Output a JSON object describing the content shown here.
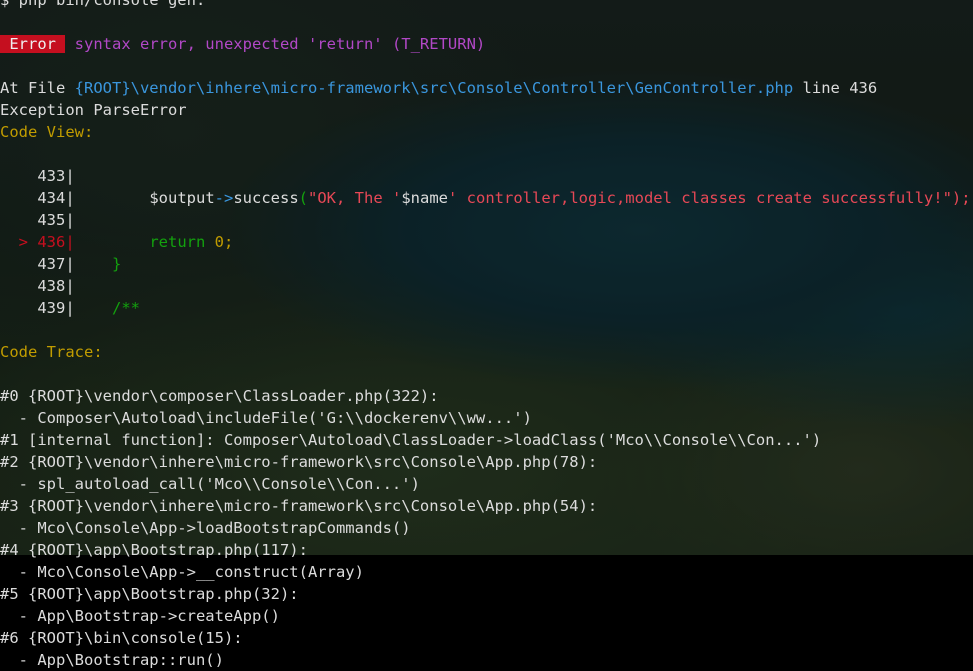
{
  "terminal": {
    "prompt": "$ php bin/console gen:",
    "error_badge": " Error ",
    "error_message": " syntax error, unexpected 'return' (T_RETURN)",
    "at_file_prefix": "At File ",
    "at_file_path": "{ROOT}\\vendor\\inhere\\micro-framework\\src\\Console\\Controller\\GenController.php",
    "at_file_line": " line 436",
    "exception": "Exception ParseError",
    "code_view_title": "Code View:",
    "code_lines": [
      {
        "num": "433",
        "arrow": "    ",
        "code": ""
      },
      {
        "num": "434",
        "arrow": "    ",
        "code_a": "        $output",
        "code_b": "->",
        "code_c": "success",
        "code_d": "(",
        "code_e": "\"OK, The '",
        "code_f": "$name",
        "code_g": "' controller,logic,model classes create successfully!\");"
      },
      {
        "num": "435",
        "arrow": "    ",
        "code": ""
      },
      {
        "num": "436",
        "arrow": "  > ",
        "code_a": "        return ",
        "code_b": "0;"
      },
      {
        "num": "437",
        "arrow": "    ",
        "code": "    }"
      },
      {
        "num": "438",
        "arrow": "    ",
        "code": ""
      },
      {
        "num": "439",
        "arrow": "    ",
        "code": "    /**"
      }
    ],
    "code_trace_title": "Code Trace:",
    "trace": [
      "#0 {ROOT}\\vendor\\composer\\ClassLoader.php(322):",
      "  - Composer\\Autoload\\includeFile('G:\\\\dockerenv\\\\ww...')",
      "#1 [internal function]: Composer\\Autoload\\ClassLoader->loadClass('Mco\\\\Console\\\\Con...')",
      "#2 {ROOT}\\vendor\\inhere\\micro-framework\\src\\Console\\App.php(78):",
      "  - spl_autoload_call('Mco\\\\Console\\\\Con...')",
      "#3 {ROOT}\\vendor\\inhere\\micro-framework\\src\\Console\\App.php(54):",
      "  - Mco\\Console\\App->loadBootstrapCommands()",
      "#4 {ROOT}\\app\\Bootstrap.php(117):",
      "  - Mco\\Console\\App->__construct(Array)",
      "#5 {ROOT}\\app\\Bootstrap.php(32):",
      "  - App\\Bootstrap->createApp()",
      "#6 {ROOT}\\bin\\console(15):",
      "  - App\\Bootstrap::run()"
    ]
  },
  "colors": {
    "background": "#000000",
    "text": "#dcdcdc",
    "cyan": "#3a96dd",
    "green": "#13a10e",
    "red": "#e74856",
    "magenta": "#b148c6",
    "yellow": "#c19c00",
    "error_badge_bg": "#c50f1f"
  }
}
